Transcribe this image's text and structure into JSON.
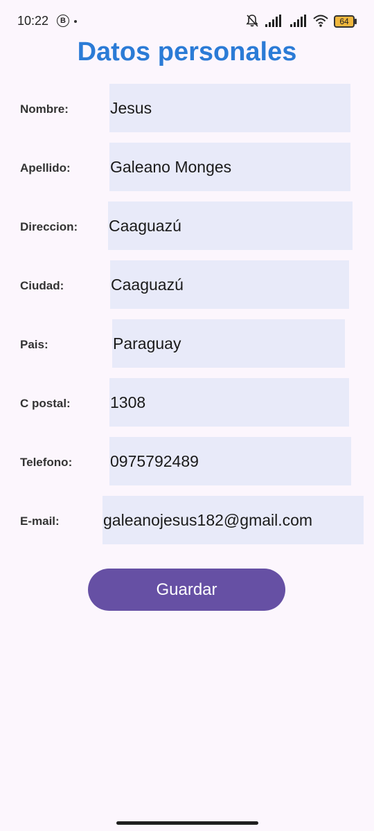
{
  "status_bar": {
    "time": "10:22",
    "notification_badge": "B",
    "battery": "64",
    "icons": [
      "bell-muted-icon",
      "signal-icon",
      "signal-icon",
      "wifi-icon",
      "battery-icon"
    ]
  },
  "title": "Datos personales",
  "form": {
    "nombre": {
      "label": "Nombre:",
      "value": "Jesus"
    },
    "apellido": {
      "label": "Apellido:",
      "value": "Galeano Monges"
    },
    "direccion": {
      "label": "Direccion:",
      "value": "Caaguazú"
    },
    "ciudad": {
      "label": "Ciudad:",
      "value": "Caaguazú"
    },
    "pais": {
      "label": "Pais:",
      "value": "Paraguay"
    },
    "cpostal": {
      "label": "C postal:",
      "value": "1308"
    },
    "telefono": {
      "label": "Telefono:",
      "value": "0975792489"
    },
    "email": {
      "label": "E-mail:",
      "value": "galeanojesus182@gmail.com"
    }
  },
  "save_label": "Guardar",
  "colors": {
    "title": "#2b7bd6",
    "button": "#6650a4",
    "input_bg": "#e8eaf9",
    "background": "#fcf6fd"
  }
}
